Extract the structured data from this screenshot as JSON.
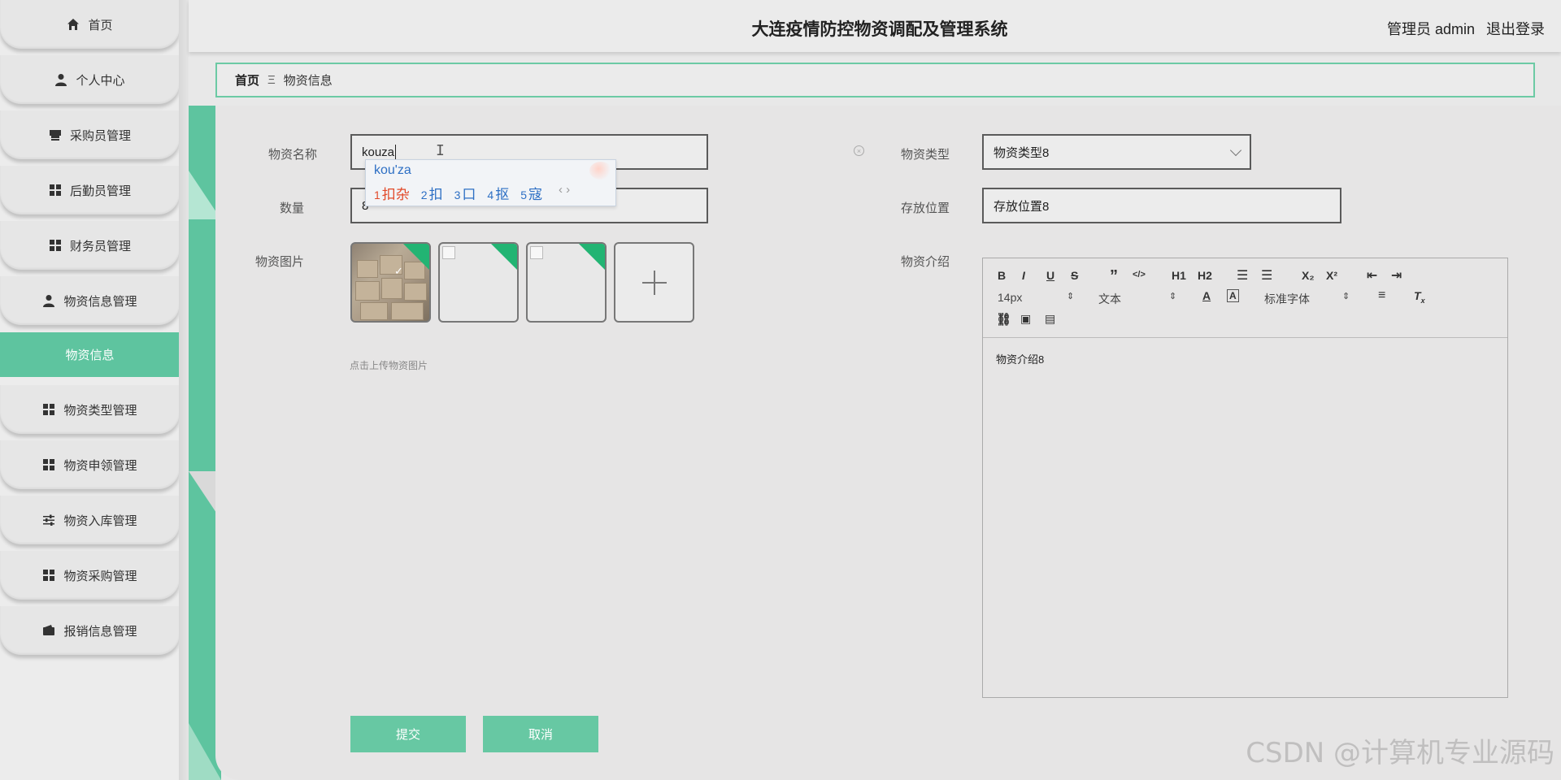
{
  "app": {
    "title": "大连疫情防控物资调配及管理系统"
  },
  "user": {
    "label": "管理员 admin",
    "logout": "退出登录"
  },
  "sidebar": {
    "items": [
      {
        "label": "首页",
        "icon": "home-icon"
      },
      {
        "label": "个人中心",
        "icon": "user-icon"
      },
      {
        "label": "采购员管理",
        "icon": "store-icon"
      },
      {
        "label": "后勤员管理",
        "icon": "grid-icon"
      },
      {
        "label": "财务员管理",
        "icon": "grid-icon"
      },
      {
        "label": "物资信息管理",
        "icon": "user-icon"
      },
      {
        "label": "物资信息",
        "icon": "",
        "active": true
      },
      {
        "label": "物资类型管理",
        "icon": "grid-icon"
      },
      {
        "label": "物资申领管理",
        "icon": "grid-icon"
      },
      {
        "label": "物资入库管理",
        "icon": "sliders-icon"
      },
      {
        "label": "物资采购管理",
        "icon": "grid-icon"
      },
      {
        "label": "报销信息管理",
        "icon": "wallet-icon"
      }
    ]
  },
  "breadcrumb": {
    "home": "首页",
    "separator": "Ξ",
    "current": "物资信息"
  },
  "form": {
    "name_label": "物资名称",
    "name_value": "kouza",
    "quantity_label": "数量",
    "quantity_value": "8",
    "image_label": "物资图片",
    "upload_hint": "点击上传物资图片",
    "type_label": "物资类型",
    "type_value": "物资类型8",
    "location_label": "存放位置",
    "location_value": "存放位置8",
    "intro_label": "物资介绍",
    "intro_value": "物资介绍8"
  },
  "ime": {
    "typed": "kou'za",
    "candidates": [
      {
        "num": "1",
        "text": "扣杂"
      },
      {
        "num": "2",
        "text": "扣"
      },
      {
        "num": "3",
        "text": "口"
      },
      {
        "num": "4",
        "text": "抠"
      },
      {
        "num": "5",
        "text": "寇"
      }
    ],
    "nav": "‹ ›"
  },
  "editor": {
    "font_size": "14px",
    "block": "文本",
    "font_family": "标准字体",
    "buttons": [
      "B",
      "I",
      "U",
      "S",
      "”",
      "</>",
      "H1",
      "H2",
      "ol",
      "ul",
      "X₂",
      "X²"
    ]
  },
  "actions": {
    "submit": "提交",
    "cancel": "取消"
  },
  "watermark": "CSDN @计算机专业源码",
  "colors": {
    "accent": "#5ec49f",
    "ime_first": "#e24a2a",
    "ime_text": "#2d6fc4",
    "thumb_corner": "#22b473"
  }
}
